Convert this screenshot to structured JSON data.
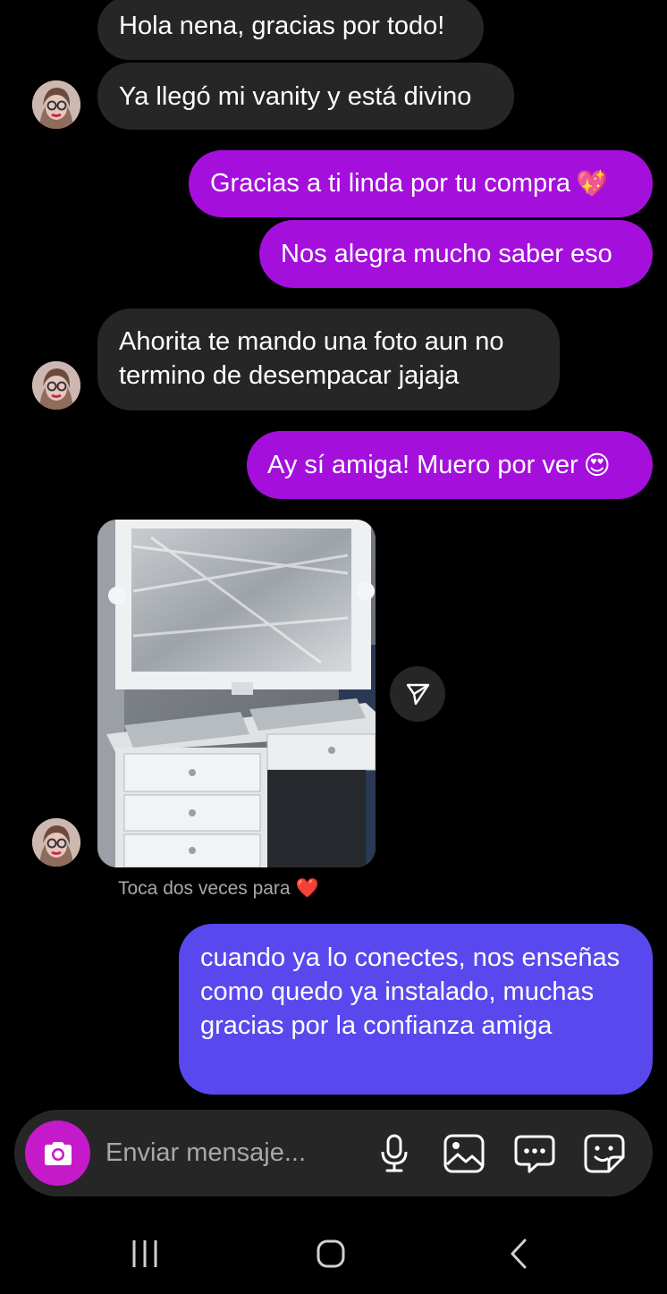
{
  "messages": {
    "m1": "Hola nena, gracias por todo!",
    "m2": "Ya llegó mi vanity y está divino",
    "m3": "Gracias a ti linda por tu compra",
    "m3_emoji": "💖",
    "m4": "Nos alegra mucho saber eso",
    "m5_line1": "Ahorita te mando una foto aun no",
    "m5_line2": "termino de desempacar jajaja",
    "m6": "Ay sí amiga! Muero por ver",
    "m6_emoji": "😍",
    "photo_caption": "Toca dos veces para",
    "photo_caption_emoji": "❤️",
    "m7": "cuando ya lo conectes, nos enseñas como quedo ya instalado, muchas gracias por la confianza amiga"
  },
  "composer": {
    "placeholder": "Enviar mensaje...",
    "icons": [
      "camera-icon",
      "microphone-icon",
      "gallery-icon",
      "chat-bubble-icon",
      "sticker-icon"
    ]
  },
  "navbar": {
    "icons": [
      "recent-apps-icon",
      "home-icon",
      "back-icon"
    ]
  },
  "colors": {
    "background": "#000000",
    "incoming_bubble": "#262626",
    "outgoing_bubble": "#a40fdc",
    "outgoing_bubble_latest": "#5a48ef",
    "camera_button": "#c51ac9",
    "muted_text": "#a8a8a8"
  }
}
